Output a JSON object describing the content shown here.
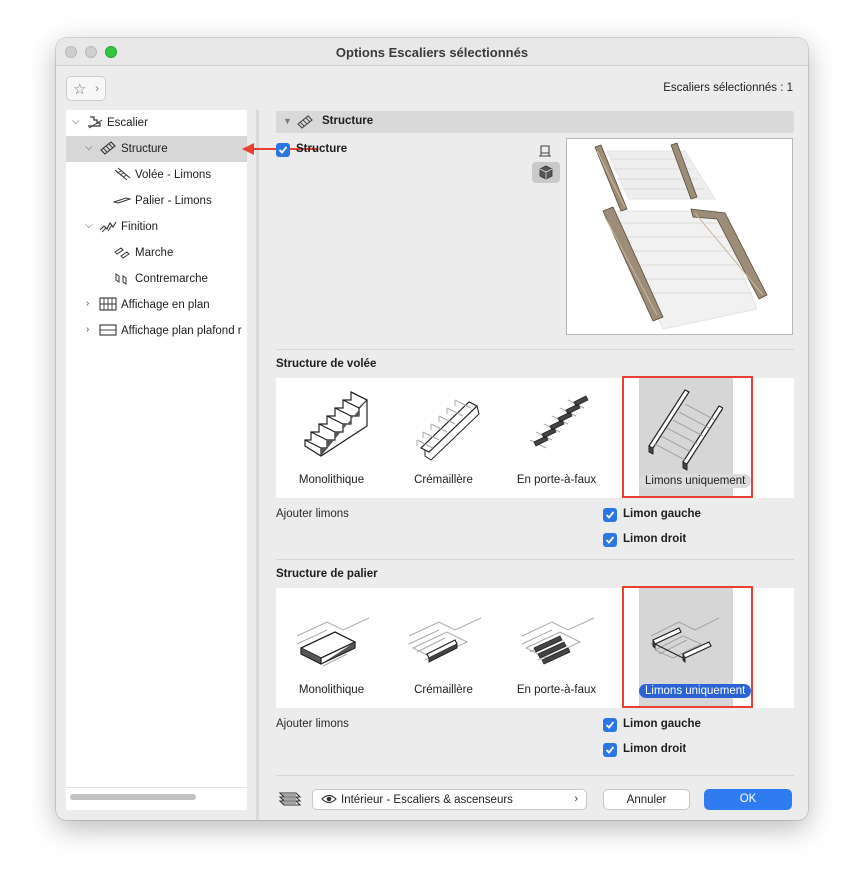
{
  "window": {
    "title": "Options Escaliers sélectionnés"
  },
  "header": {
    "selected_count": "Escaliers sélectionnés : 1"
  },
  "tree": {
    "items": [
      {
        "label": "Escalier"
      },
      {
        "label": "Structure"
      },
      {
        "label": "Volée - Limons"
      },
      {
        "label": "Palier - Limons"
      },
      {
        "label": "Finition"
      },
      {
        "label": "Marche"
      },
      {
        "label": "Contremarche"
      },
      {
        "label": "Affichage en plan"
      },
      {
        "label": "Affichage plan plafond r"
      }
    ]
  },
  "section": {
    "title": "Structure",
    "structure_checkbox": {
      "label": "Structure",
      "checked": true
    }
  },
  "flight": {
    "title": "Structure de volée",
    "options": [
      "Monolithique",
      "Crémaillère",
      "En porte-à-faux",
      "Limons uniquement"
    ],
    "selected": "Limons uniquement",
    "add_label": "Ajouter limons",
    "left_stringer": {
      "label": "Limon gauche",
      "checked": true
    },
    "right_stringer": {
      "label": "Limon droit",
      "checked": true
    }
  },
  "landing": {
    "title": "Structure de palier",
    "options": [
      "Monolithique",
      "Crémaillère",
      "En porte-à-faux",
      "Limons uniquement"
    ],
    "selected": "Limons uniquement",
    "add_label": "Ajouter limons",
    "left_stringer": {
      "label": "Limon gauche",
      "checked": true
    },
    "right_stringer": {
      "label": "Limon droit",
      "checked": true
    }
  },
  "footer": {
    "view_preset": "Intérieur - Escaliers & ascenseurs",
    "cancel_label": "Annuler",
    "ok_label": "OK"
  },
  "colors": {
    "accent": "#2f7bf0",
    "checkbox": "#2a76e3",
    "highlight_box": "#e8412f",
    "selected_pill": "#2a63d6"
  }
}
